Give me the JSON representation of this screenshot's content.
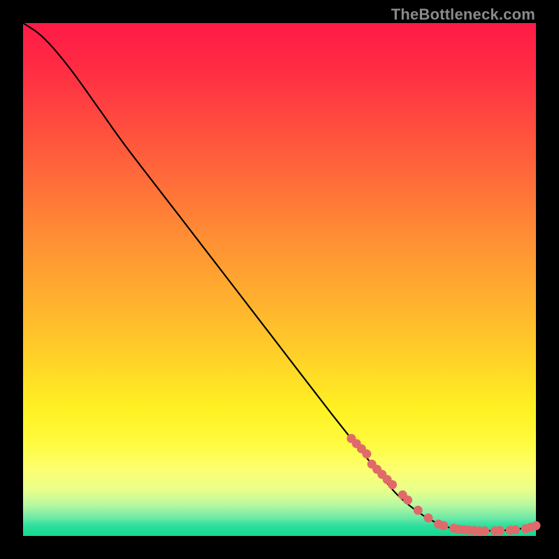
{
  "source_label": "TheBottleneck.com",
  "colors": {
    "frame_bg": "#000000",
    "curve": "#000000",
    "marker": "#e06a6a"
  },
  "chart_data": {
    "type": "line",
    "title": "",
    "xlabel": "",
    "ylabel": "",
    "xlim": [
      0,
      100
    ],
    "ylim": [
      0,
      100
    ],
    "series": [
      {
        "name": "curve",
        "x": [
          0,
          3,
          6,
          10,
          15,
          20,
          30,
          40,
          50,
          60,
          68,
          73,
          78,
          82,
          85,
          87,
          90,
          94,
          97,
          100
        ],
        "y": [
          100,
          98,
          95,
          90,
          83,
          76,
          63,
          50,
          37,
          24,
          14,
          8,
          4,
          2,
          1.2,
          1,
          1,
          1.1,
          1.4,
          2
        ]
      }
    ],
    "markers": {
      "name": "highlighted-points",
      "x": [
        64,
        65,
        66,
        67,
        68,
        69,
        70,
        71,
        72,
        74,
        75,
        77,
        79,
        81,
        82,
        84,
        85,
        86,
        87,
        88,
        89,
        90,
        92,
        93,
        95,
        96,
        98,
        99,
        100
      ],
      "y": [
        19,
        18,
        17,
        16,
        14,
        13,
        12,
        11,
        10,
        8,
        7,
        5,
        3.5,
        2.3,
        2,
        1.5,
        1.3,
        1.2,
        1.1,
        1.05,
        1,
        1,
        1,
        1.05,
        1.1,
        1.2,
        1.4,
        1.7,
        2
      ]
    }
  }
}
